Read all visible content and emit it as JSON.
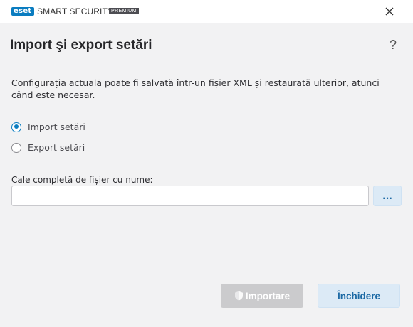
{
  "titlebar": {
    "logo_text": "eset",
    "product_name": "SMART SECURITY",
    "edition": "PREMIUM",
    "close_icon": "close-icon"
  },
  "dialog": {
    "title": "Import şi export setări",
    "help_label": "?",
    "description": "Configurația actuală poate fi salvată într-un fișier XML și restaurată ulterior, atunci când este necesar.",
    "options": [
      {
        "label": "Import setări",
        "selected": true
      },
      {
        "label": "Export setări",
        "selected": false
      }
    ],
    "path_field": {
      "label": "Cale completă de fișier cu nume:",
      "value": "",
      "placeholder": ""
    },
    "browse_label": "...",
    "buttons": {
      "import_label": "Importare",
      "import_icon": "shield-icon",
      "import_enabled": false,
      "close_label": "Închidere"
    }
  },
  "colors": {
    "accent": "#0a7cc0",
    "button_light": "#dceaf6",
    "disabled": "#cbcbcd"
  }
}
